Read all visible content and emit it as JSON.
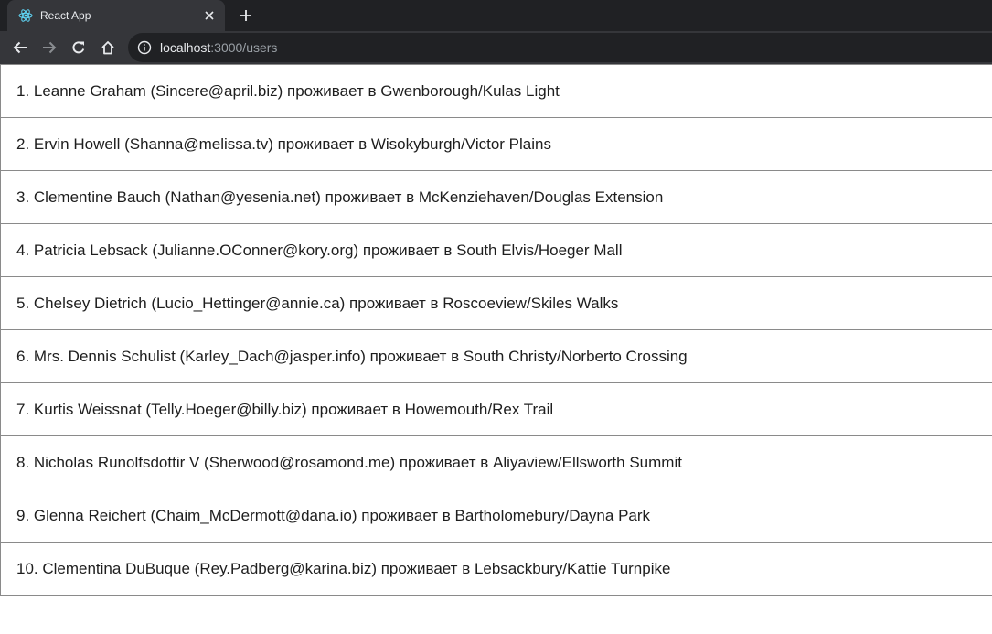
{
  "browser": {
    "tab_title": "React App",
    "url_host": "localhost",
    "url_path": ":3000/users"
  },
  "users": [
    "1. Leanne Graham (Sincere@april.biz) проживает в Gwenborough/Kulas Light",
    "2. Ervin Howell (Shanna@melissa.tv) проживает в Wisokyburgh/Victor Plains",
    "3. Clementine Bauch (Nathan@yesenia.net) проживает в McKenziehaven/Douglas Extension",
    "4. Patricia Lebsack (Julianne.OConner@kory.org) проживает в South Elvis/Hoeger Mall",
    "5. Chelsey Dietrich (Lucio_Hettinger@annie.ca) проживает в Roscoeview/Skiles Walks",
    "6. Mrs. Dennis Schulist (Karley_Dach@jasper.info) проживает в South Christy/Norberto Crossing",
    "7. Kurtis Weissnat (Telly.Hoeger@billy.biz) проживает в Howemouth/Rex Trail",
    "8. Nicholas Runolfsdottir V (Sherwood@rosamond.me) проживает в Aliyaview/Ellsworth Summit",
    "9. Glenna Reichert (Chaim_McDermott@dana.io) проживает в Bartholomebury/Dayna Park",
    "10. Clementina DuBuque (Rey.Padberg@karina.biz) проживает в Lebsackbury/Kattie Turnpike"
  ]
}
